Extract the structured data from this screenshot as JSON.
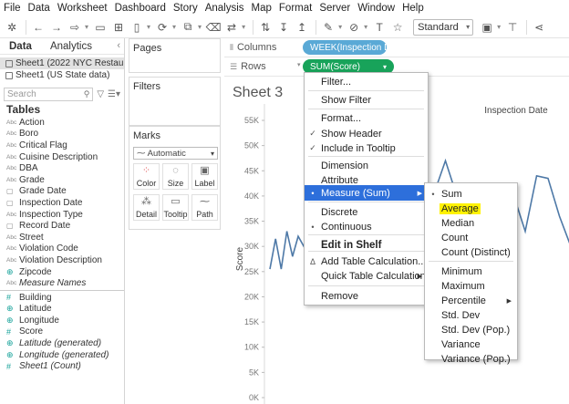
{
  "menubar": [
    "File",
    "Data",
    "Worksheet",
    "Dashboard",
    "Story",
    "Analysis",
    "Map",
    "Format",
    "Server",
    "Window",
    "Help"
  ],
  "toolbar": {
    "fit_label": "Standard"
  },
  "datapane": {
    "tabs": [
      "Data",
      "Analytics"
    ],
    "sources": [
      "Sheet1 (2022 NYC Restau...",
      "Sheet1 (US State data)"
    ],
    "search_placeholder": "Search",
    "tables_heading": "Tables",
    "dimensions": [
      {
        "type": "Abc",
        "name": "Action"
      },
      {
        "type": "Abc",
        "name": "Boro"
      },
      {
        "type": "Abc",
        "name": "Critical Flag"
      },
      {
        "type": "Abc",
        "name": "Cuisine Description"
      },
      {
        "type": "Abc",
        "name": "DBA"
      },
      {
        "type": "Abc",
        "name": "Grade"
      },
      {
        "type": "date",
        "name": "Grade Date"
      },
      {
        "type": "date",
        "name": "Inspection Date"
      },
      {
        "type": "Abc",
        "name": "Inspection Type"
      },
      {
        "type": "date",
        "name": "Record Date"
      },
      {
        "type": "Abc",
        "name": "Street"
      },
      {
        "type": "Abc",
        "name": "Violation Code"
      },
      {
        "type": "Abc",
        "name": "Violation Description"
      },
      {
        "type": "geo",
        "name": "Zipcode"
      },
      {
        "type": "Abc",
        "name": "Measure Names",
        "italic": true
      }
    ],
    "measures": [
      {
        "type": "#",
        "name": "Building"
      },
      {
        "type": "geo",
        "name": "Latitude"
      },
      {
        "type": "geo",
        "name": "Longitude"
      },
      {
        "type": "#",
        "name": "Score"
      },
      {
        "type": "geo",
        "name": "Latitude (generated)",
        "italic": true
      },
      {
        "type": "geo",
        "name": "Longitude (generated)",
        "italic": true
      },
      {
        "type": "#",
        "name": "Sheet1 (Count)",
        "italic": true
      }
    ]
  },
  "cards": {
    "pages": "Pages",
    "filters": "Filters",
    "marks": "Marks",
    "mark_type": "Automatic",
    "mark_buttons": [
      "Color",
      "Size",
      "Label",
      "Detail",
      "Tooltip",
      "Path"
    ]
  },
  "shelves": {
    "columns_label": "Columns",
    "rows_label": "Rows",
    "columns_pill": "WEEK(Inspection Dat..",
    "rows_pill": "SUM(Score)"
  },
  "view": {
    "sheet_title": "Sheet 3",
    "header": "Inspection Date",
    "y_axis_label": "Score"
  },
  "chart_data": {
    "type": "line",
    "title": "Sheet 3",
    "xlabel": "Inspection Date",
    "ylabel": "Score",
    "ylim": [
      0,
      55000
    ],
    "y_ticks": [
      "0K",
      "5K",
      "10K",
      "15K",
      "20K",
      "25K",
      "30K",
      "35K",
      "40K",
      "45K",
      "50K",
      "55K"
    ],
    "series": [
      {
        "values": [
          25500,
          31500,
          25500,
          33000,
          28000,
          32000,
          30000,
          33000
        ]
      },
      {
        "values": [
          37000,
          45500,
          45000,
          38000,
          40500,
          47000,
          40000,
          36000,
          30000,
          21000,
          28000,
          40000,
          33000,
          44000,
          43500,
          36000,
          30000
        ]
      }
    ],
    "line_color": "#4e79a7"
  },
  "context_menu": {
    "items": [
      {
        "label": "Filter...",
        "check": ""
      },
      {
        "label": "Show Filter",
        "check": ""
      },
      {
        "label": "Format...",
        "check": ""
      },
      {
        "label": "Show Header",
        "check": "✓"
      },
      {
        "label": "Include in Tooltip",
        "check": "✓"
      },
      {
        "label": "Dimension",
        "check": ""
      },
      {
        "label": "Attribute",
        "check": ""
      },
      {
        "label": "Measure (Sum)",
        "check": "•",
        "submenu": true,
        "highlighted": true
      },
      {
        "label": "Discrete",
        "check": ""
      },
      {
        "label": "Continuous",
        "check": "•"
      },
      {
        "label": "Edit in Shelf",
        "check": "",
        "bold": true
      },
      {
        "label": "Add Table Calculation...",
        "check": "Δ"
      },
      {
        "label": "Quick Table Calculation",
        "check": "",
        "submenu": true
      },
      {
        "label": "Remove",
        "check": ""
      }
    ]
  },
  "submenu": {
    "items": [
      {
        "label": "Sum",
        "check": "•"
      },
      {
        "label": "Average",
        "check": "",
        "annotated": true
      },
      {
        "label": "Median",
        "check": ""
      },
      {
        "label": "Count",
        "check": ""
      },
      {
        "label": "Count (Distinct)",
        "check": ""
      },
      {
        "label": "Minimum",
        "check": ""
      },
      {
        "label": "Maximum",
        "check": ""
      },
      {
        "label": "Percentile",
        "check": "",
        "submenu": true
      },
      {
        "label": "Std. Dev",
        "check": ""
      },
      {
        "label": "Std. Dev (Pop.)",
        "check": ""
      },
      {
        "label": "Variance",
        "check": ""
      },
      {
        "label": "Variance (Pop.)",
        "check": ""
      }
    ]
  }
}
